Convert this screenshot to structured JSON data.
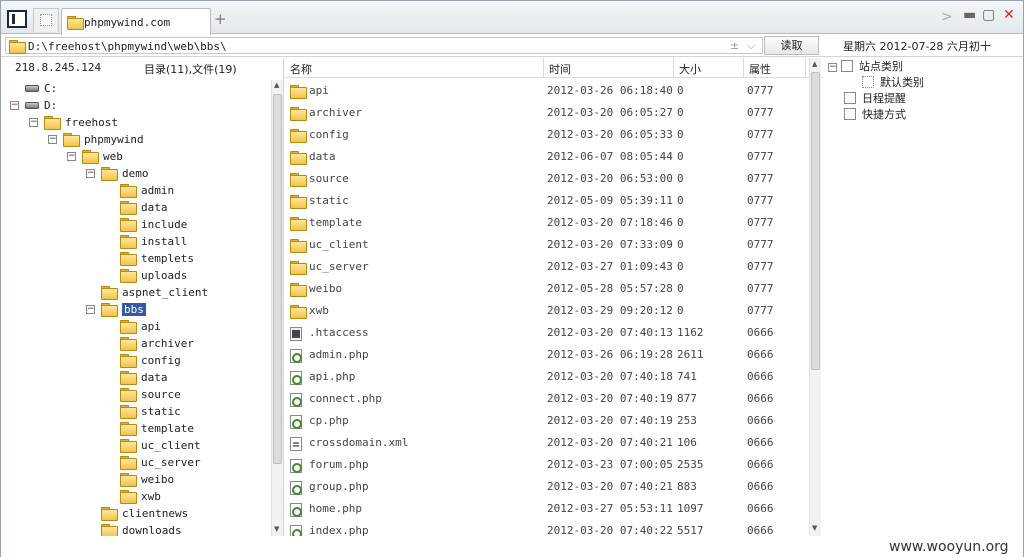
{
  "tab": {
    "title": "phpmywind.com"
  },
  "address": {
    "path": "D:\\freehost\\phpmywind\\web\\bbs\\",
    "read_label": "读取",
    "date_text": "星期六 2012-07-28 六月初十"
  },
  "left": {
    "ip": "218.8.245.124",
    "counts": "目录(11),文件(19)"
  },
  "tree": [
    {
      "label": "C:",
      "level": 0,
      "type": "drive",
      "toggle": ""
    },
    {
      "label": "D:",
      "level": 0,
      "type": "drive",
      "toggle": "−"
    },
    {
      "label": "freehost",
      "level": 1,
      "type": "folder",
      "toggle": "−"
    },
    {
      "label": "phpmywind",
      "level": 2,
      "type": "folder",
      "toggle": "−"
    },
    {
      "label": "web",
      "level": 3,
      "type": "folder",
      "toggle": "−"
    },
    {
      "label": "demo",
      "level": 4,
      "type": "folder",
      "toggle": "−"
    },
    {
      "label": "admin",
      "level": 5,
      "type": "folder",
      "toggle": ""
    },
    {
      "label": "data",
      "level": 5,
      "type": "folder",
      "toggle": ""
    },
    {
      "label": "include",
      "level": 5,
      "type": "folder",
      "toggle": ""
    },
    {
      "label": "install",
      "level": 5,
      "type": "folder",
      "toggle": ""
    },
    {
      "label": "templets",
      "level": 5,
      "type": "folder",
      "toggle": ""
    },
    {
      "label": "uploads",
      "level": 5,
      "type": "folder",
      "toggle": ""
    },
    {
      "label": "aspnet_client",
      "level": 4,
      "type": "folder",
      "toggle": ""
    },
    {
      "label": "bbs",
      "level": 4,
      "type": "folder",
      "toggle": "−",
      "selected": true
    },
    {
      "label": "api",
      "level": 5,
      "type": "folder",
      "toggle": ""
    },
    {
      "label": "archiver",
      "level": 5,
      "type": "folder",
      "toggle": ""
    },
    {
      "label": "config",
      "level": 5,
      "type": "folder",
      "toggle": ""
    },
    {
      "label": "data",
      "level": 5,
      "type": "folder",
      "toggle": ""
    },
    {
      "label": "source",
      "level": 5,
      "type": "folder",
      "toggle": ""
    },
    {
      "label": "static",
      "level": 5,
      "type": "folder",
      "toggle": ""
    },
    {
      "label": "template",
      "level": 5,
      "type": "folder",
      "toggle": ""
    },
    {
      "label": "uc_client",
      "level": 5,
      "type": "folder",
      "toggle": ""
    },
    {
      "label": "uc_server",
      "level": 5,
      "type": "folder",
      "toggle": ""
    },
    {
      "label": "weibo",
      "level": 5,
      "type": "folder",
      "toggle": ""
    },
    {
      "label": "xwb",
      "level": 5,
      "type": "folder",
      "toggle": ""
    },
    {
      "label": "clientnews",
      "level": 4,
      "type": "folder",
      "toggle": ""
    },
    {
      "label": "downloads",
      "level": 4,
      "type": "folder",
      "toggle": ""
    }
  ],
  "columns": {
    "name": "名称",
    "time": "时间",
    "size": "大小",
    "attr": "属性"
  },
  "files": [
    {
      "name": "api",
      "time": "2012-03-26 06:18:40",
      "size": "0",
      "attr": "0777",
      "icon": "folder"
    },
    {
      "name": "archiver",
      "time": "2012-03-20 06:05:27",
      "size": "0",
      "attr": "0777",
      "icon": "folder"
    },
    {
      "name": "config",
      "time": "2012-03-20 06:05:33",
      "size": "0",
      "attr": "0777",
      "icon": "folder"
    },
    {
      "name": "data",
      "time": "2012-06-07 08:05:44",
      "size": "0",
      "attr": "0777",
      "icon": "folder"
    },
    {
      "name": "source",
      "time": "2012-03-20 06:53:00",
      "size": "0",
      "attr": "0777",
      "icon": "folder"
    },
    {
      "name": "static",
      "time": "2012-05-09 05:39:11",
      "size": "0",
      "attr": "0777",
      "icon": "folder"
    },
    {
      "name": "template",
      "time": "2012-03-20 07:18:46",
      "size": "0",
      "attr": "0777",
      "icon": "folder"
    },
    {
      "name": "uc_client",
      "time": "2012-03-20 07:33:09",
      "size": "0",
      "attr": "0777",
      "icon": "folder"
    },
    {
      "name": "uc_server",
      "time": "2012-03-27 01:09:43",
      "size": "0",
      "attr": "0777",
      "icon": "folder"
    },
    {
      "name": "weibo",
      "time": "2012-05-28 05:57:28",
      "size": "0",
      "attr": "0777",
      "icon": "folder"
    },
    {
      "name": "xwb",
      "time": "2012-03-29 09:20:12",
      "size": "0",
      "attr": "0777",
      "icon": "folder"
    },
    {
      "name": ".htaccess",
      "time": "2012-03-20 07:40:13",
      "size": "1162",
      "attr": "0666",
      "icon": "ht"
    },
    {
      "name": "admin.php",
      "time": "2012-03-26 06:19:28",
      "size": "2611",
      "attr": "0666",
      "icon": "php"
    },
    {
      "name": "api.php",
      "time": "2012-03-20 07:40:18",
      "size": "741",
      "attr": "0666",
      "icon": "php"
    },
    {
      "name": "connect.php",
      "time": "2012-03-20 07:40:19",
      "size": "877",
      "attr": "0666",
      "icon": "php"
    },
    {
      "name": "cp.php",
      "time": "2012-03-20 07:40:19",
      "size": "253",
      "attr": "0666",
      "icon": "php"
    },
    {
      "name": "crossdomain.xml",
      "time": "2012-03-20 07:40:21",
      "size": "106",
      "attr": "0666",
      "icon": "xml"
    },
    {
      "name": "forum.php",
      "time": "2012-03-23 07:00:05",
      "size": "2535",
      "attr": "0666",
      "icon": "php"
    },
    {
      "name": "group.php",
      "time": "2012-03-20 07:40:21",
      "size": "883",
      "attr": "0666",
      "icon": "php"
    },
    {
      "name": "home.php",
      "time": "2012-03-27 05:53:11",
      "size": "1097",
      "attr": "0666",
      "icon": "php"
    },
    {
      "name": "index.php",
      "time": "2012-03-20 07:40:22",
      "size": "5517",
      "attr": "0666",
      "icon": "php"
    }
  ],
  "right_panel": {
    "site_category": "站点类别",
    "default_category": "默认类别",
    "schedule": "日程提醒",
    "shortcuts": "快捷方式"
  },
  "watermark": "www.wooyun.org"
}
